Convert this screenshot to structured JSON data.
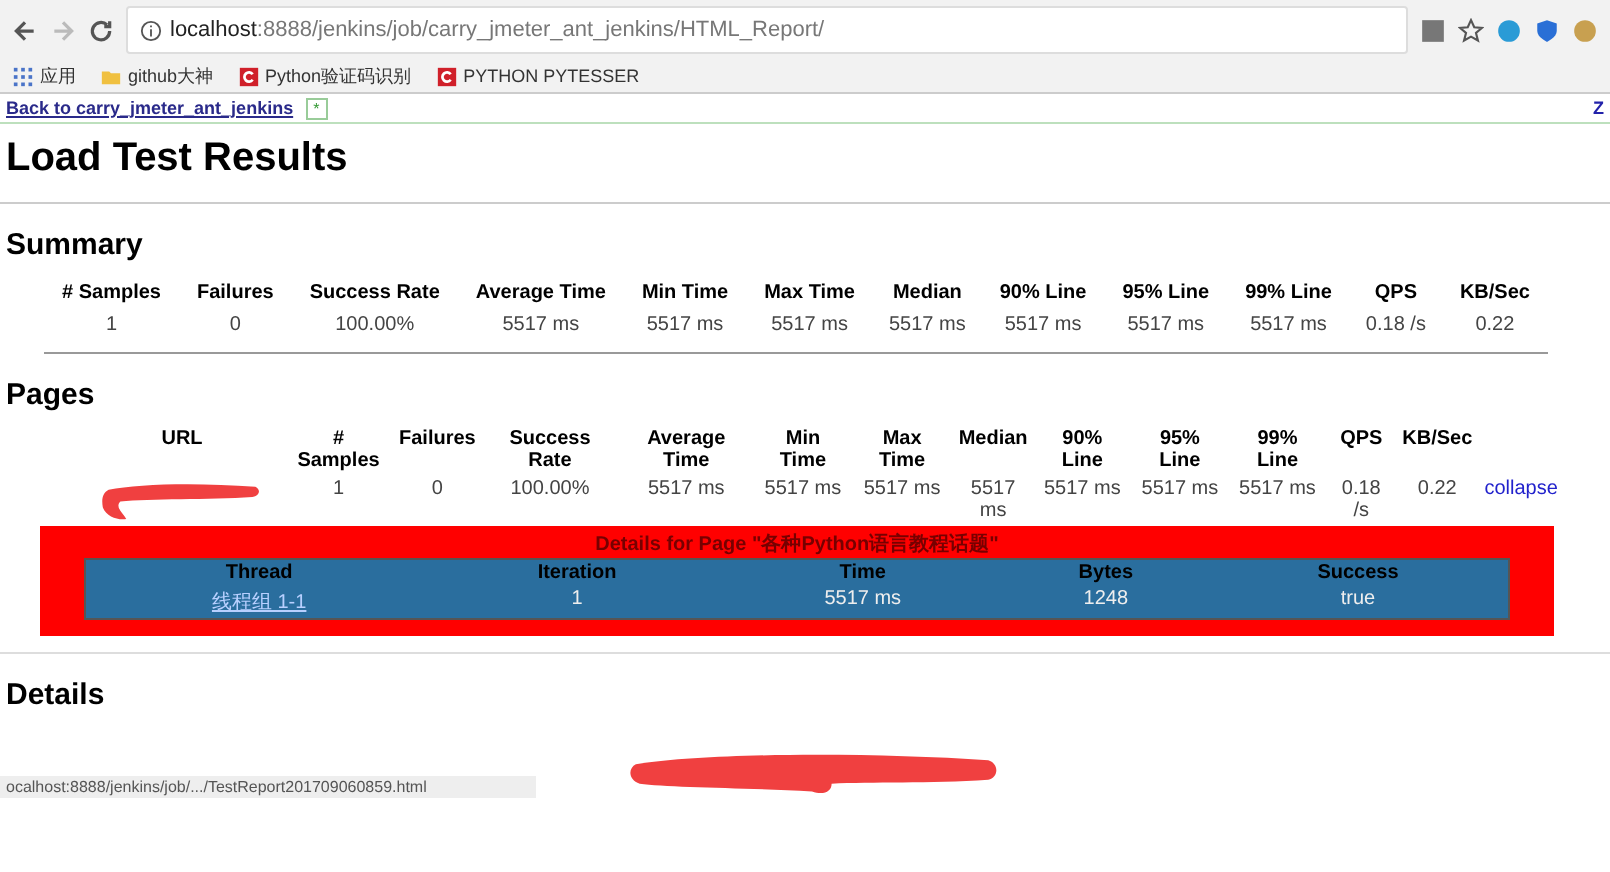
{
  "browser": {
    "url_host": "localhost",
    "url_rest": ":8888/jenkins/job/carry_jmeter_ant_jenkins/HTML_Report/",
    "bookmarks": [
      {
        "label": "应用",
        "kind": "apps"
      },
      {
        "label": "github大神",
        "kind": "folder"
      },
      {
        "label": "Python验证码识别",
        "kind": "site"
      },
      {
        "label": "PYTHON PYTESSER",
        "kind": "site"
      }
    ]
  },
  "tab_strip": {
    "back_link": "Back to carry_jmeter_ant_jenkins",
    "tab_mark": "*",
    "edge_text": "Z"
  },
  "title": "Load Test Results",
  "summary": {
    "heading": "Summary",
    "columns": [
      "# Samples",
      "Failures",
      "Success Rate",
      "Average Time",
      "Min Time",
      "Max Time",
      "Median",
      "90% Line",
      "95% Line",
      "99% Line",
      "QPS",
      "KB/Sec"
    ],
    "rows": [
      [
        "1",
        "0",
        "100.00%",
        "5517 ms",
        "5517 ms",
        "5517 ms",
        "5517 ms",
        "5517 ms",
        "5517 ms",
        "5517 ms",
        "0.18 /s",
        "0.22"
      ]
    ]
  },
  "pages": {
    "heading": "Pages",
    "columns": [
      "URL",
      "# Samples",
      "Failures",
      "Success Rate",
      "Average Time",
      "Min Time",
      "Max Time",
      "Median",
      "90% Line",
      "95% Line",
      "99% Line",
      "QPS",
      "KB/Sec"
    ],
    "rows": [
      {
        "url_redacted": true,
        "cells": [
          "",
          "1",
          "0",
          "100.00%",
          "5517 ms",
          "5517 ms",
          "5517 ms",
          "5517 ms",
          "5517 ms",
          "5517 ms",
          "5517 ms",
          "0.18 /s",
          "0.22"
        ],
        "toggle": "collapse",
        "expanded": true,
        "details": {
          "title": "Details for Page \"各种Python语言教程话题\"",
          "columns": [
            "Thread",
            "Iteration",
            "Time",
            "Bytes",
            "Success"
          ],
          "rows": [
            [
              "线程组 1-1",
              "1",
              "5517 ms",
              "1248",
              "true"
            ]
          ]
        }
      }
    ]
  },
  "details": {
    "heading": "Details"
  },
  "status_bar": "ocalhost:8888/jenkins/job/.../TestReport201709060859.html"
}
